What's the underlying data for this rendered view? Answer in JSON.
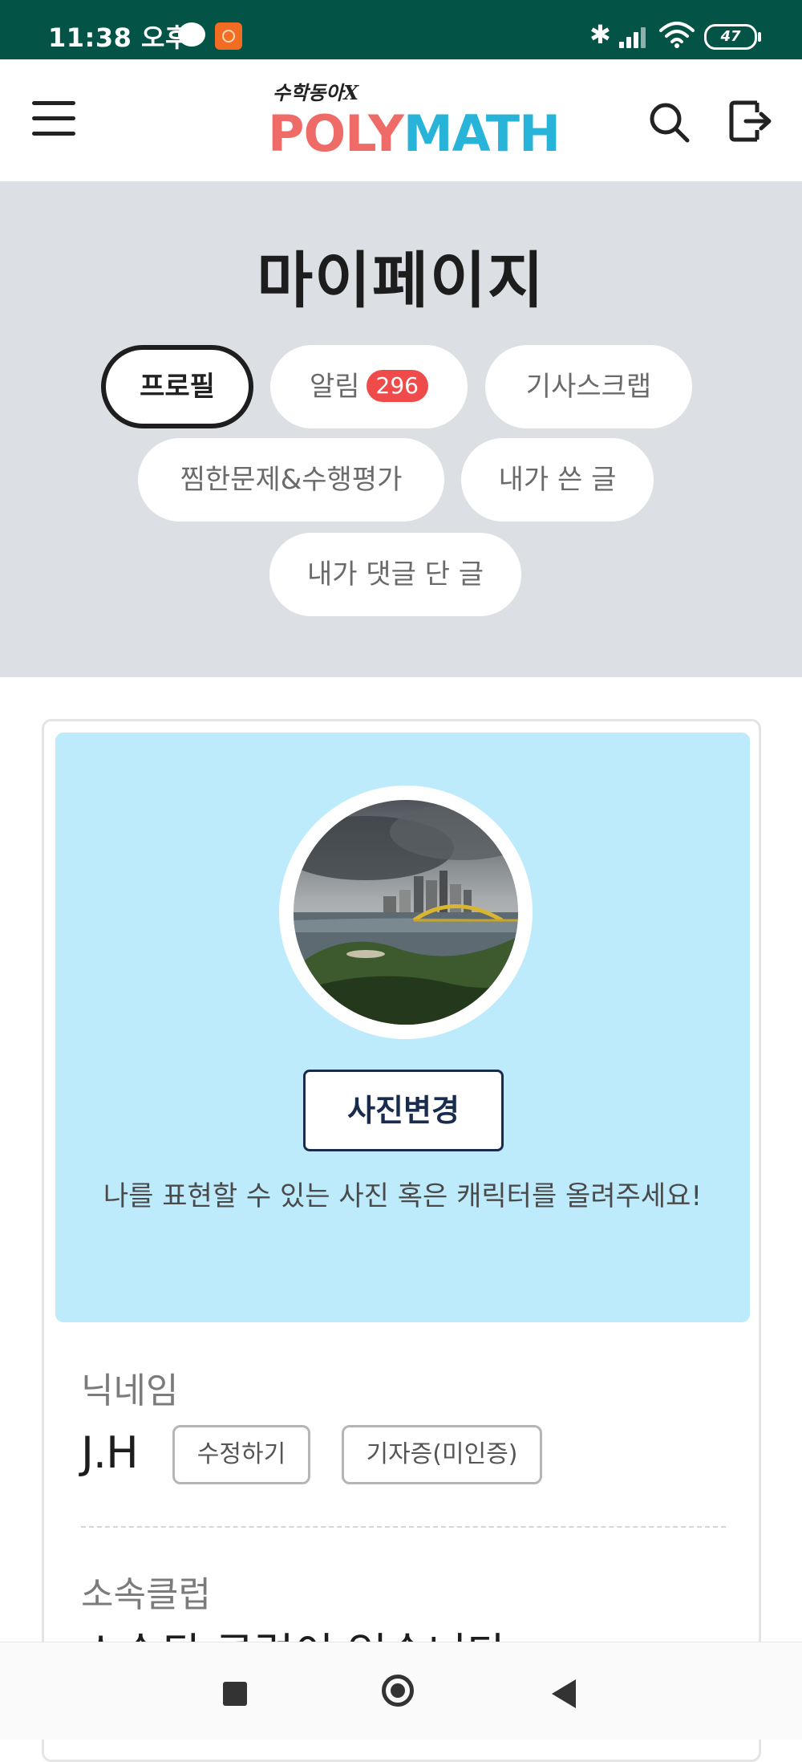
{
  "status_bar": {
    "time": "11:38 오후",
    "battery": "47"
  },
  "header": {
    "logo_small": "수학동아X",
    "logo_poly": "POLY",
    "logo_math": "MATH"
  },
  "page": {
    "title": "마이페이지"
  },
  "tabs": [
    {
      "label": "프로필",
      "active": true
    },
    {
      "label": "알림",
      "badge": "296"
    },
    {
      "label": "기사스크랩"
    },
    {
      "label": "찜한문제&수행평가"
    },
    {
      "label": "내가 쓴 글"
    },
    {
      "label": "내가 댓글 단 글"
    }
  ],
  "profile": {
    "change_photo_label": "사진변경",
    "photo_hint": "나를 표현할 수 있는 사진 혹은 캐릭터를 올려주세요!",
    "nickname_label": "닉네임",
    "nickname": "J.H",
    "edit_label": "수정하기",
    "press_card_label": "기자증(미인증)",
    "club_label": "소속클럽",
    "club_value": "소속된 클럽이 없습니다"
  },
  "colors": {
    "status_bar": "#035446",
    "hero_bg": "#dcdfe4",
    "photo_panel": "#bdebfc",
    "badge": "#f04b4b",
    "logo_poly": "#ef6b68",
    "logo_math": "#27b4d8",
    "button_border": "#1a2c4e"
  },
  "icons": {
    "menu": "hamburger-icon",
    "search": "search-icon",
    "logout": "logout-icon",
    "nav_recent": "square-icon",
    "nav_home": "circle-home-icon",
    "nav_back": "triangle-back-icon"
  }
}
